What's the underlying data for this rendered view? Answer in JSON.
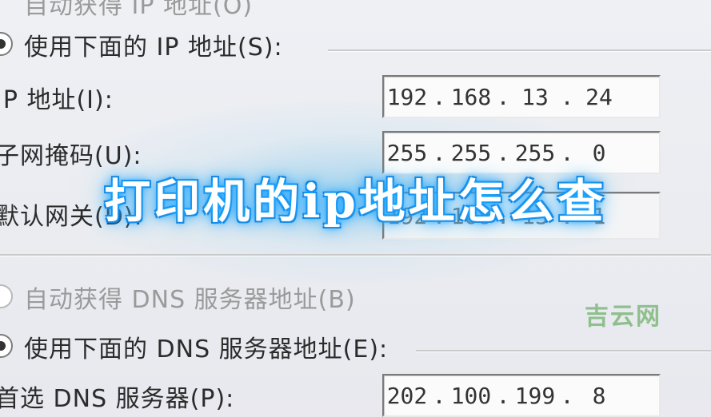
{
  "dialog": {
    "auto_ip_label": "自动获得 IP 地址(O)",
    "manual_ip_label": "使用下面的 IP 地址(S):",
    "ip_address_label": "IP 地址(I):",
    "ip_address": [
      "192",
      "168",
      "13",
      "24"
    ],
    "subnet_label": "子网掩码(U):",
    "subnet_mask": [
      "255",
      "255",
      "255",
      "0"
    ],
    "gateway_label": "默认网关(D):",
    "gateway": [
      "192",
      "168",
      "13",
      "1"
    ],
    "auto_dns_label": "自动获得 DNS 服务器地址(B)",
    "manual_dns_label": "使用下面的 DNS 服务器地址(E):",
    "preferred_dns_label": "首选 DNS 服务器(P):",
    "preferred_dns": [
      "202",
      "100",
      "199",
      "8"
    ]
  },
  "overlay": {
    "title": "打印机的ip地址怎么查",
    "watermark": "吉云网"
  }
}
